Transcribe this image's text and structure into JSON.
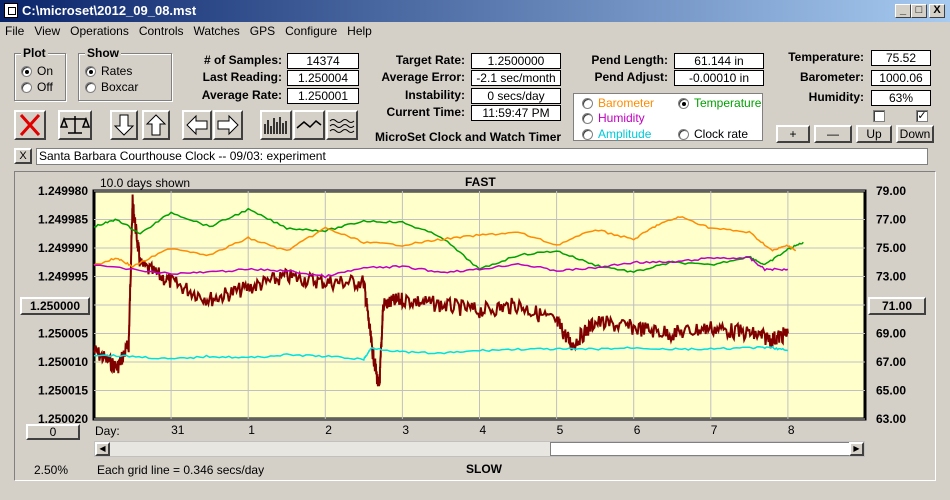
{
  "window": {
    "title": "C:\\microset\\2012_09_08.mst",
    "min": "_",
    "max": "□",
    "close": "X"
  },
  "menu": [
    "File",
    "View",
    "Operations",
    "Controls",
    "Watches",
    "GPS",
    "Configure",
    "Help"
  ],
  "plot_group": {
    "title": "Plot",
    "options": [
      "On",
      "Off"
    ],
    "selected": "On"
  },
  "show_group": {
    "title": "Show",
    "options": [
      "Rates",
      "Boxcar"
    ],
    "selected": "Rates"
  },
  "stats": {
    "samples_label": "# of Samples:",
    "samples": "14374",
    "last_label": "Last Reading:",
    "last": "1.250004",
    "avg_label": "Average Rate:",
    "avg": "1.250001",
    "target_label": "Target Rate:",
    "target": "1.2500000",
    "error_label": "Average Error:",
    "error": "-2.1 sec/month",
    "instab_label": "Instability:",
    "instab": "0 secs/day",
    "time_label": "Current Time:",
    "time": "11:59:47 PM",
    "pendlen_label": "Pend Length:",
    "pendlen": "61.144 in",
    "pendadj_label": "Pend Adjust:",
    "pendadj": "-0.00010 in",
    "temp_label": "Temperature:",
    "temp": "75.52",
    "baro_label": "Barometer:",
    "baro": "1000.06",
    "hum_label": "Humidity:",
    "hum": "63%"
  },
  "app_caption": "MicroSet Clock and Watch Timer",
  "sensor_options": {
    "barometer": "Barometer",
    "temperature": "Temperature",
    "humidity": "Humidity",
    "amplitude": "Amplitude",
    "clockrate": "Clock rate",
    "selected": "Temperature"
  },
  "colors": {
    "barometer": "#ff8c00",
    "temperature": "#00a000",
    "humidity": "#c000c0",
    "amplitude": "#00e0e0",
    "rate": "#800000",
    "plotbg": "#ffffcc"
  },
  "scale_buttons": {
    "plus": "+",
    "minus": "—",
    "up": "Up",
    "down": "Down"
  },
  "note": {
    "close": "X",
    "text": "Santa Barbara Courthouse Clock  --  09/03: experiment"
  },
  "plot": {
    "days_shown": "10.0 days shown",
    "fast": "FAST",
    "slow": "SLOW",
    "grid_note": "Each grid line = 0.346 secs/day",
    "pct": "2.50%",
    "day_label": "Day:",
    "left_btn": "1.250000",
    "right_btn": "71.00",
    "bottom_btn": "0"
  },
  "chart_data": {
    "type": "line",
    "xlabel": "Day:",
    "x_ticks": [
      "31",
      "1",
      "2",
      "3",
      "4",
      "5",
      "6",
      "7",
      "8"
    ],
    "left_axis": {
      "ticks": [
        "1.249980",
        "1.249985",
        "1.249990",
        "1.249995",
        "1.250000",
        "1.250005",
        "1.250010",
        "1.250015",
        "1.250020"
      ],
      "range": [
        1.24998,
        1.25002
      ],
      "inverted": true
    },
    "right_axis": {
      "ticks": [
        "79.00",
        "77.00",
        "75.00",
        "73.00",
        "71.00",
        "69.00",
        "67.00",
        "65.00",
        "63.00"
      ],
      "range": [
        63,
        79
      ]
    },
    "x_range": [
      30,
      40
    ],
    "series": [
      {
        "key": "rate",
        "points": [
          [
            30,
            1.250008
          ],
          [
            30.3,
            1.250011
          ],
          [
            30.45,
            1.250007
          ],
          [
            30.5,
            1.249982
          ],
          [
            30.6,
            1.249993
          ],
          [
            31,
            1.249996
          ],
          [
            31.5,
            1.249999
          ],
          [
            32,
            1.249997
          ],
          [
            32.5,
            1.249995
          ],
          [
            33,
            1.249996
          ],
          [
            33.5,
            1.249996
          ],
          [
            33.6,
            1.250007
          ],
          [
            33.7,
            1.250015
          ],
          [
            33.75,
            1.25
          ],
          [
            34,
            1.249999
          ],
          [
            34.5,
            1.25
          ],
          [
            35,
            1.250001
          ],
          [
            35.5,
            1.25
          ],
          [
            36,
            1.250003
          ],
          [
            36.2,
            1.250007
          ],
          [
            36.5,
            1.250003
          ],
          [
            37,
            1.250004
          ],
          [
            37.5,
            1.250005
          ],
          [
            38,
            1.250004
          ],
          [
            38.5,
            1.250005
          ],
          [
            38.8,
            1.250006
          ],
          [
            39,
            1.250005
          ]
        ]
      },
      {
        "key": "temperature",
        "points": [
          [
            30,
            76.5
          ],
          [
            30.3,
            77
          ],
          [
            30.6,
            76
          ],
          [
            31,
            77.5
          ],
          [
            31.5,
            76.5
          ],
          [
            32,
            77.7
          ],
          [
            32.5,
            76.4
          ],
          [
            33,
            76.2
          ],
          [
            33.5,
            76.9
          ],
          [
            34,
            76.8
          ],
          [
            34.5,
            75.8
          ],
          [
            35,
            73.5
          ],
          [
            35.5,
            74.5
          ],
          [
            36,
            74.8
          ],
          [
            36.5,
            73.8
          ],
          [
            37,
            73.3
          ],
          [
            37.5,
            74
          ],
          [
            38,
            73.8
          ],
          [
            38.5,
            74.4
          ],
          [
            38.7,
            73.8
          ],
          [
            39,
            74.9
          ],
          [
            39.2,
            75.4
          ]
        ]
      },
      {
        "key": "barometer",
        "points": [
          [
            30,
            73.8
          ],
          [
            30.3,
            74.3
          ],
          [
            30.5,
            73.7
          ],
          [
            31,
            75
          ],
          [
            31.5,
            74.5
          ],
          [
            32,
            75.7
          ],
          [
            32.5,
            74.8
          ],
          [
            33,
            76.4
          ],
          [
            33.5,
            75.4
          ],
          [
            34,
            75.2
          ],
          [
            34.5,
            75.6
          ],
          [
            35,
            75.9
          ],
          [
            35.5,
            76.1
          ],
          [
            36,
            75.2
          ],
          [
            36.5,
            76.3
          ],
          [
            37,
            75.6
          ],
          [
            37.3,
            76.6
          ],
          [
            37.6,
            77.2
          ],
          [
            38,
            76.4
          ],
          [
            38.5,
            76.1
          ],
          [
            38.8,
            74.8
          ],
          [
            39,
            75.2
          ],
          [
            39.1,
            74.8
          ]
        ]
      },
      {
        "key": "humidity",
        "points": [
          [
            30,
            73.8
          ],
          [
            31,
            73.2
          ],
          [
            31.5,
            73.3
          ],
          [
            32,
            73.5
          ],
          [
            32.5,
            73.4
          ],
          [
            33,
            73
          ],
          [
            33.5,
            73.6
          ],
          [
            34,
            73.7
          ],
          [
            34.5,
            73.3
          ],
          [
            35,
            73.5
          ],
          [
            35.5,
            73.9
          ],
          [
            36,
            73.4
          ],
          [
            36.5,
            73.6
          ],
          [
            37,
            74
          ],
          [
            37.5,
            74
          ],
          [
            38,
            74.3
          ],
          [
            38.5,
            74.3
          ],
          [
            38.7,
            73.5
          ],
          [
            39,
            73.5
          ]
        ]
      },
      {
        "key": "amplitude",
        "points": [
          [
            30,
            67.5
          ],
          [
            30.5,
            67.4
          ],
          [
            31,
            67.2
          ],
          [
            31.5,
            67.4
          ],
          [
            32,
            67.3
          ],
          [
            32.5,
            67.5
          ],
          [
            33,
            67.4
          ],
          [
            33.5,
            67.2
          ],
          [
            33.6,
            68
          ],
          [
            34,
            67.7
          ],
          [
            34.5,
            67.6
          ],
          [
            35,
            67.8
          ],
          [
            35.5,
            67.9
          ],
          [
            36,
            67.9
          ],
          [
            36.5,
            67.9
          ],
          [
            37,
            68
          ],
          [
            37.5,
            67.9
          ],
          [
            38,
            67.9
          ],
          [
            38.5,
            68
          ],
          [
            38.8,
            68
          ],
          [
            39,
            67.8
          ]
        ]
      }
    ]
  }
}
